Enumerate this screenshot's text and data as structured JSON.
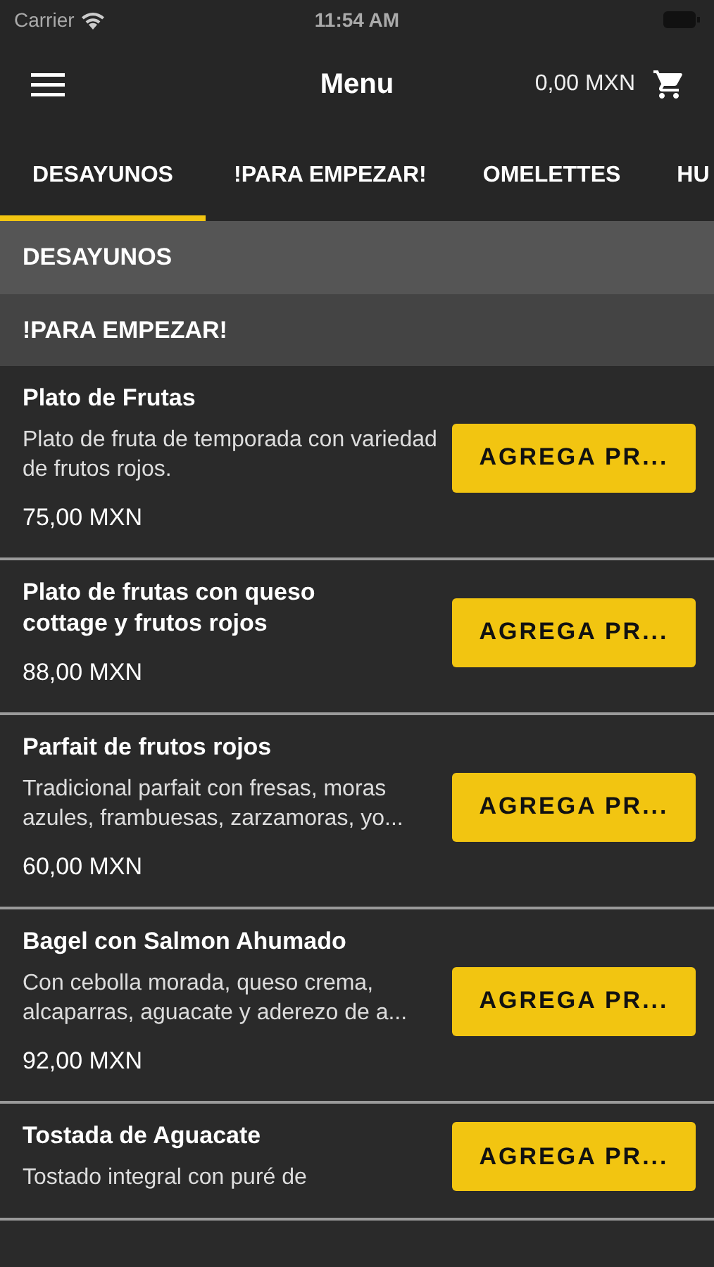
{
  "status_bar": {
    "carrier": "Carrier",
    "time": "11:54 AM"
  },
  "nav": {
    "title": "Menu",
    "cart_total": "0,00 MXN"
  },
  "tabs": [
    {
      "label": "DESAYUNOS",
      "selected": true
    },
    {
      "label": "!PARA EMPEZAR!",
      "selected": false
    },
    {
      "label": "OMELETTES",
      "selected": false
    },
    {
      "label": "HU",
      "selected": false
    }
  ],
  "sections": [
    {
      "title": "DESAYUNOS",
      "kind": "category"
    },
    {
      "title": "!PARA EMPEZAR!",
      "kind": "subcategory"
    }
  ],
  "products": [
    {
      "name": "Plato de Frutas",
      "description": "Plato de fruta de temporada con variedad de frutos rojos.",
      "price": "75,00 MXN",
      "button": "AGREGA PR..."
    },
    {
      "name": "Plato de frutas con queso cottage y frutos rojos",
      "price": "88,00 MXN",
      "button": "AGREGA PR..."
    },
    {
      "name": "Parfait de frutos rojos",
      "description": "Tradicional parfait con fresas, moras azules, frambuesas, zarzamoras, yo...",
      "price": "60,00 MXN",
      "button": "AGREGA PR..."
    },
    {
      "name": "Bagel con Salmon Ahumado",
      "description": "Con cebolla morada, queso crema, alcaparras, aguacate y aderezo de a...",
      "price": "92,00 MXN",
      "button": "AGREGA PR..."
    },
    {
      "name": "Tostada de Aguacate",
      "description": "Tostado integral con puré de",
      "button": "AGREGA PR..."
    }
  ]
}
